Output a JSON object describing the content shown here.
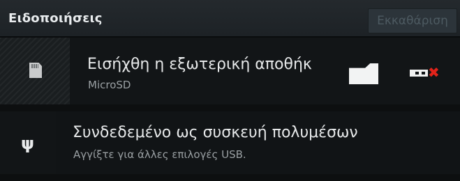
{
  "header": {
    "title": "Ειδοποιήσεις",
    "clear_label": "Εκκαθάριση"
  },
  "notifications": [
    {
      "title": "Εισήχθη η εξωτερική αποθήκ",
      "subtitle": "MicroSD",
      "icon": "sd-card-icon",
      "actions": [
        "folder-icon",
        "eject-icon"
      ]
    },
    {
      "title": "Συνδεδεμένο ως συσκευή πολυμέσων",
      "subtitle": "Αγγίξτε για άλλες επιλογές USB.",
      "icon": "usb-icon"
    }
  ],
  "colors": {
    "background": "#0d0f10",
    "header": "#1d2226",
    "eject_accent": "#e2231a"
  }
}
